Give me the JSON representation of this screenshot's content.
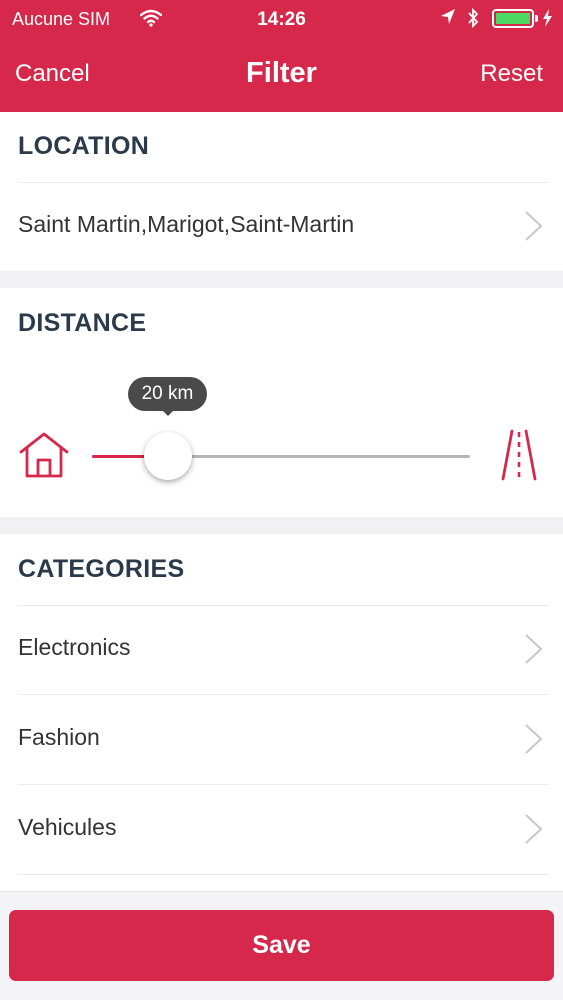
{
  "status_bar": {
    "carrier": "Aucune SIM",
    "time": "14:26",
    "icons": [
      "wifi-icon",
      "location-arrow-icon",
      "bluetooth-icon",
      "battery-icon",
      "charging-icon"
    ]
  },
  "nav": {
    "cancel": "Cancel",
    "title": "Filter",
    "reset": "Reset"
  },
  "location": {
    "title": "LOCATION",
    "value": "Saint Martin,Marigot,Saint-Martin"
  },
  "distance": {
    "title": "DISTANCE",
    "value_label": "20 km",
    "level": 0.2,
    "icons": [
      "home-icon",
      "road-icon"
    ]
  },
  "categories": {
    "title": "CATEGORIES",
    "items": [
      {
        "label": "Electronics"
      },
      {
        "label": "Fashion"
      },
      {
        "label": "Vehicules"
      }
    ]
  },
  "footer": {
    "save": "Save"
  },
  "colors": {
    "accent": "#d5284b",
    "section_title": "#2b3a4a",
    "section_gap": "#f1f1f3",
    "battery": "#4cd964"
  }
}
